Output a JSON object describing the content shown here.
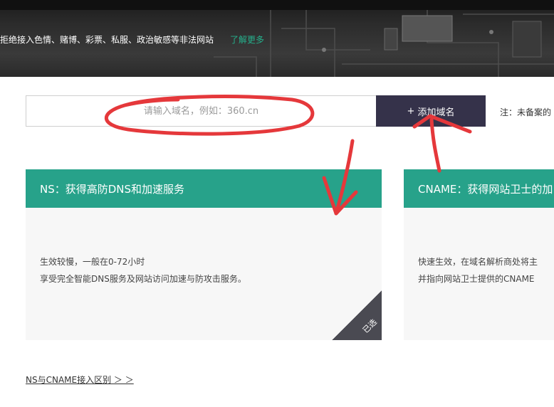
{
  "banner": {
    "notice": "拒绝接入色情、赌博、彩票、私服、政治敏感等非法网站",
    "more_link": "了解更多"
  },
  "search": {
    "placeholder": "请输入域名，例如：360.cn"
  },
  "add_button": {
    "icon": "+",
    "label": "添加域名"
  },
  "note": "注：未备案的",
  "cards": {
    "ns": {
      "title": "NS：获得高防DNS和加速服务",
      "line1": "生效较慢，一般在0-72小时",
      "line2": "享受完全智能DNS服务及网站访问加速与防攻击服务。",
      "selected_label": "已选"
    },
    "cname": {
      "title": "CNAME：获得网站卫士的加",
      "line1": "快速生效，在域名解析商处将主",
      "line2": "并指向网站卫士提供的CNAME"
    }
  },
  "diff_link": "NS与CNAME接入区别 ＞ ＞",
  "colors": {
    "accent_green": "#27a28a",
    "button_dark": "#35324a",
    "link_green": "#25b08c",
    "annotation_red": "#e5383b"
  }
}
